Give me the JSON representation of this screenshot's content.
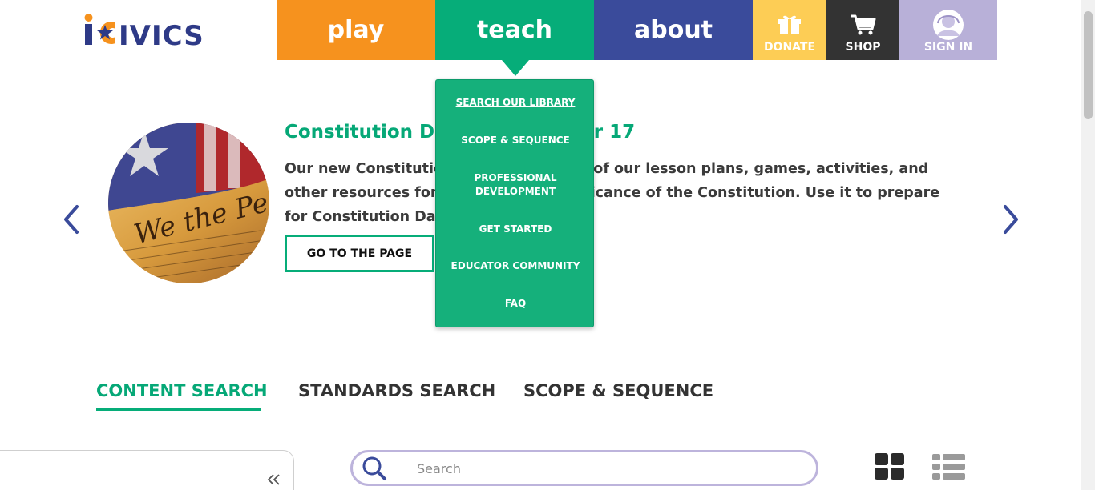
{
  "logo": {
    "text": "iCIVICS"
  },
  "nav": {
    "play": "play",
    "teach": "teach",
    "about": "about",
    "donate": "DONATE",
    "shop": "SHOP",
    "signin": "SIGN IN"
  },
  "colors": {
    "play": "#f6921e",
    "teach": "#06ad79",
    "about": "#3a4b9b",
    "donate": "#fdcd55",
    "shop": "#333333",
    "signin": "#b8b0d8",
    "accent": "#06a877"
  },
  "teach_menu": {
    "items": [
      "SEARCH OUR LIBRARY",
      "SCOPE & SEQUENCE",
      "PROFESSIONAL DEVELOPMENT",
      "GET STARTED",
      "EDUCATOR COMMUNITY",
      "FAQ"
    ]
  },
  "hero": {
    "title": "Constitution Day is September 17",
    "description": "Our new Constitution Day page has all of our lesson plans, games, activities, and other resources for teaching the significance of the Constitution. Use it to prepare for Constitution Day on September 17.",
    "button": "GO TO THE PAGE",
    "image_icon": "we-the-people-flag-image"
  },
  "tabs": {
    "content": "CONTENT SEARCH",
    "standards": "STANDARDS SEARCH",
    "scope": "SCOPE & SEQUENCE"
  },
  "search": {
    "placeholder": "Search",
    "value": ""
  },
  "icons": {
    "prev": "chevron-left-icon",
    "next": "chevron-right-icon",
    "donate": "gift-icon",
    "shop": "cart-icon",
    "signin": "user-avatar-icon",
    "search": "search-icon",
    "grid": "grid-view-icon",
    "list": "list-view-icon",
    "collapse": "double-chevron-left-icon"
  }
}
